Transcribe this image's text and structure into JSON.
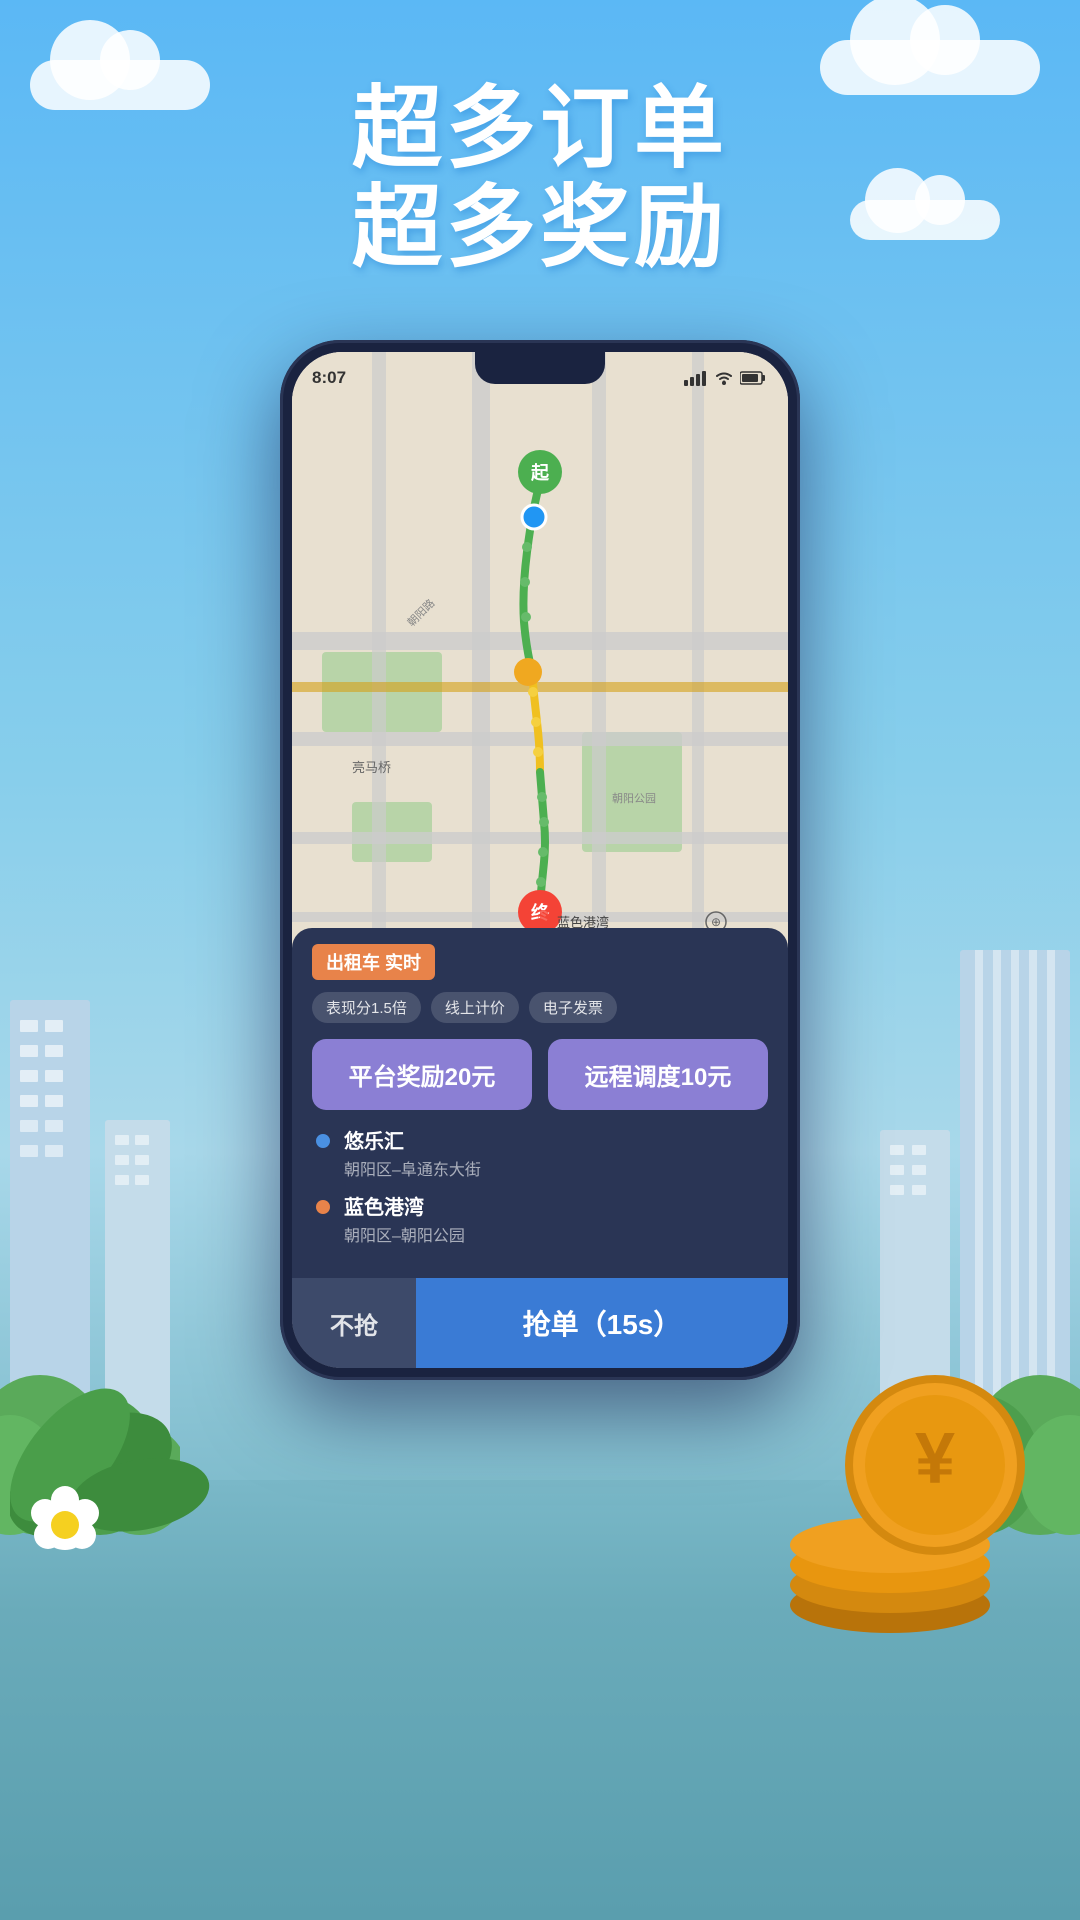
{
  "app": {
    "title": "超多订单",
    "subtitle": "超多奖励"
  },
  "status_bar": {
    "time": "8:07",
    "signal_icon": "signal",
    "wifi_icon": "wifi",
    "battery_icon": "battery"
  },
  "map": {
    "start_label": "起",
    "end_label": "终",
    "destination_name": "蓝色港湾",
    "place_labels": [
      "亮马桥",
      "蓝色港湾"
    ]
  },
  "order_panel": {
    "order_type": "出租车 实时",
    "tags": [
      "表现分1.5倍",
      "线上计价",
      "电子发票"
    ],
    "rewards": [
      {
        "label": "平台奖励20元"
      },
      {
        "label": "远程调度10元"
      }
    ],
    "locations": [
      {
        "name": "悠乐汇",
        "address": "朝阳区–阜通东大街",
        "dot_type": "blue"
      },
      {
        "name": "蓝色港湾",
        "address": "朝阳区–朝阳公园",
        "dot_type": "orange"
      }
    ],
    "btn_pass": "不抢",
    "btn_grab": "抢单（15s）"
  }
}
